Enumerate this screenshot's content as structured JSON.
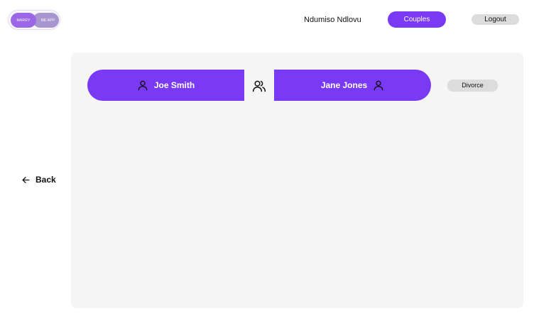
{
  "header": {
    "logo": {
      "left_text": "MARRY",
      "right_text": "ME APP"
    },
    "user_name": "Ndumiso Ndlovu",
    "couples_label": "Couples",
    "logout_label": "Logout"
  },
  "nav": {
    "back_label": "Back",
    "back_icon": "arrow-left-icon"
  },
  "couple": {
    "partner_1": {
      "name": "Joe Smith",
      "icon": "user-icon"
    },
    "link_icon": "users-icon",
    "partner_2": {
      "name": "Jane Jones",
      "icon": "user-icon"
    },
    "divorce_label": "Divorce"
  },
  "colors": {
    "accent": "#7a3af5",
    "panel": "#f5f5f5",
    "button_gray": "#dcdcdc"
  }
}
